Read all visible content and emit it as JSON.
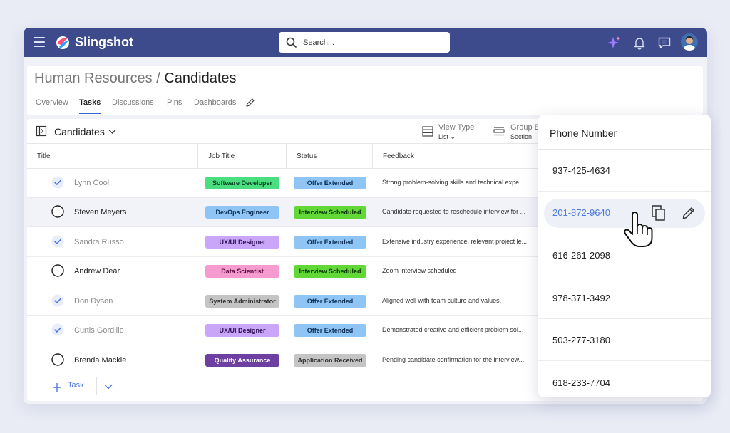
{
  "app": {
    "brand": "Slingshot"
  },
  "search": {
    "placeholder": "Search..."
  },
  "breadcrumb": {
    "parent": "Human Resources",
    "separator": "/",
    "current": "Candidates"
  },
  "tabs": [
    "Overview",
    "Tasks",
    "Discussions",
    "Pins",
    "Dashboards"
  ],
  "active_tab": "Tasks",
  "toolbar": {
    "list_name": "Candidates",
    "view_type_label": "View Type",
    "view_type_value": "List",
    "group_by_label": "Group B",
    "group_by_value": "Section"
  },
  "columns": [
    "Title",
    "Job Title",
    "Status",
    "Feedback"
  ],
  "rows": [
    {
      "done": true,
      "title": "Lynn Cool",
      "job": "Software Developer",
      "status": "Offer Extended",
      "feedback": "Strong problem-solving skills and technical expe..."
    },
    {
      "done": false,
      "title": "Steven Meyers",
      "job": "DevOps Engineer",
      "status": "Interview Scheduled",
      "feedback": "Candidate requested to reschedule interview for ..."
    },
    {
      "done": true,
      "title": "Sandra Russo",
      "job": "UX/UI Designer",
      "status": "Offer Extended",
      "feedback": "Extensive industry experience, relevant project le..."
    },
    {
      "done": false,
      "title": "Andrew Dear",
      "job": "Data Scientist",
      "status": "Interview Scheduled",
      "feedback": "Zoom interview scheduled"
    },
    {
      "done": true,
      "title": "Don Dyson",
      "job": "System Administrator",
      "status": "Offer Extended",
      "feedback": "Aligned well with team culture and values."
    },
    {
      "done": true,
      "title": "Curtis Gordillo",
      "job": "UX/UI Designer",
      "status": "Offer Extended",
      "feedback": "Demonstrated creative and efficient problem-sol..."
    },
    {
      "done": false,
      "title": "Brenda Mackie",
      "job": "Quality Assurance",
      "status": "Application Received",
      "feedback": "Pending candidate confirmation for the interview..."
    }
  ],
  "add_task_label": "Task",
  "popup": {
    "title": "Phone Number",
    "numbers": [
      "937-425-4634",
      "201-872-9640",
      "616-261-2098",
      "978-371-3492",
      "503-277-3180",
      "618-233-7704"
    ],
    "active_index": 1
  },
  "colors": {
    "topbar": "#3d4a8c",
    "accent": "#4a78e0",
    "job_colors": {
      "Software Developer": [
        "#4ade80",
        "#0b3d1f"
      ],
      "DevOps Engineer": [
        "#8ec5f5",
        "#0d2f55"
      ],
      "UX/UI Designer": [
        "#c9a6f7",
        "#2d1258"
      ],
      "Data Scientist": [
        "#f59bcf",
        "#5a0a3a"
      ],
      "System Administrator": [
        "#c4c4c4",
        "#333333"
      ],
      "Quality Assurance": [
        "#6d3fa0",
        "#ffffff"
      ]
    },
    "status_colors": {
      "Offer Extended": [
        "#8ec5f5",
        "#0d2f55"
      ],
      "Interview Scheduled": [
        "#62d836",
        "#0b2e05"
      ],
      "Application Received": [
        "#c4c4c4",
        "#333333"
      ]
    }
  }
}
